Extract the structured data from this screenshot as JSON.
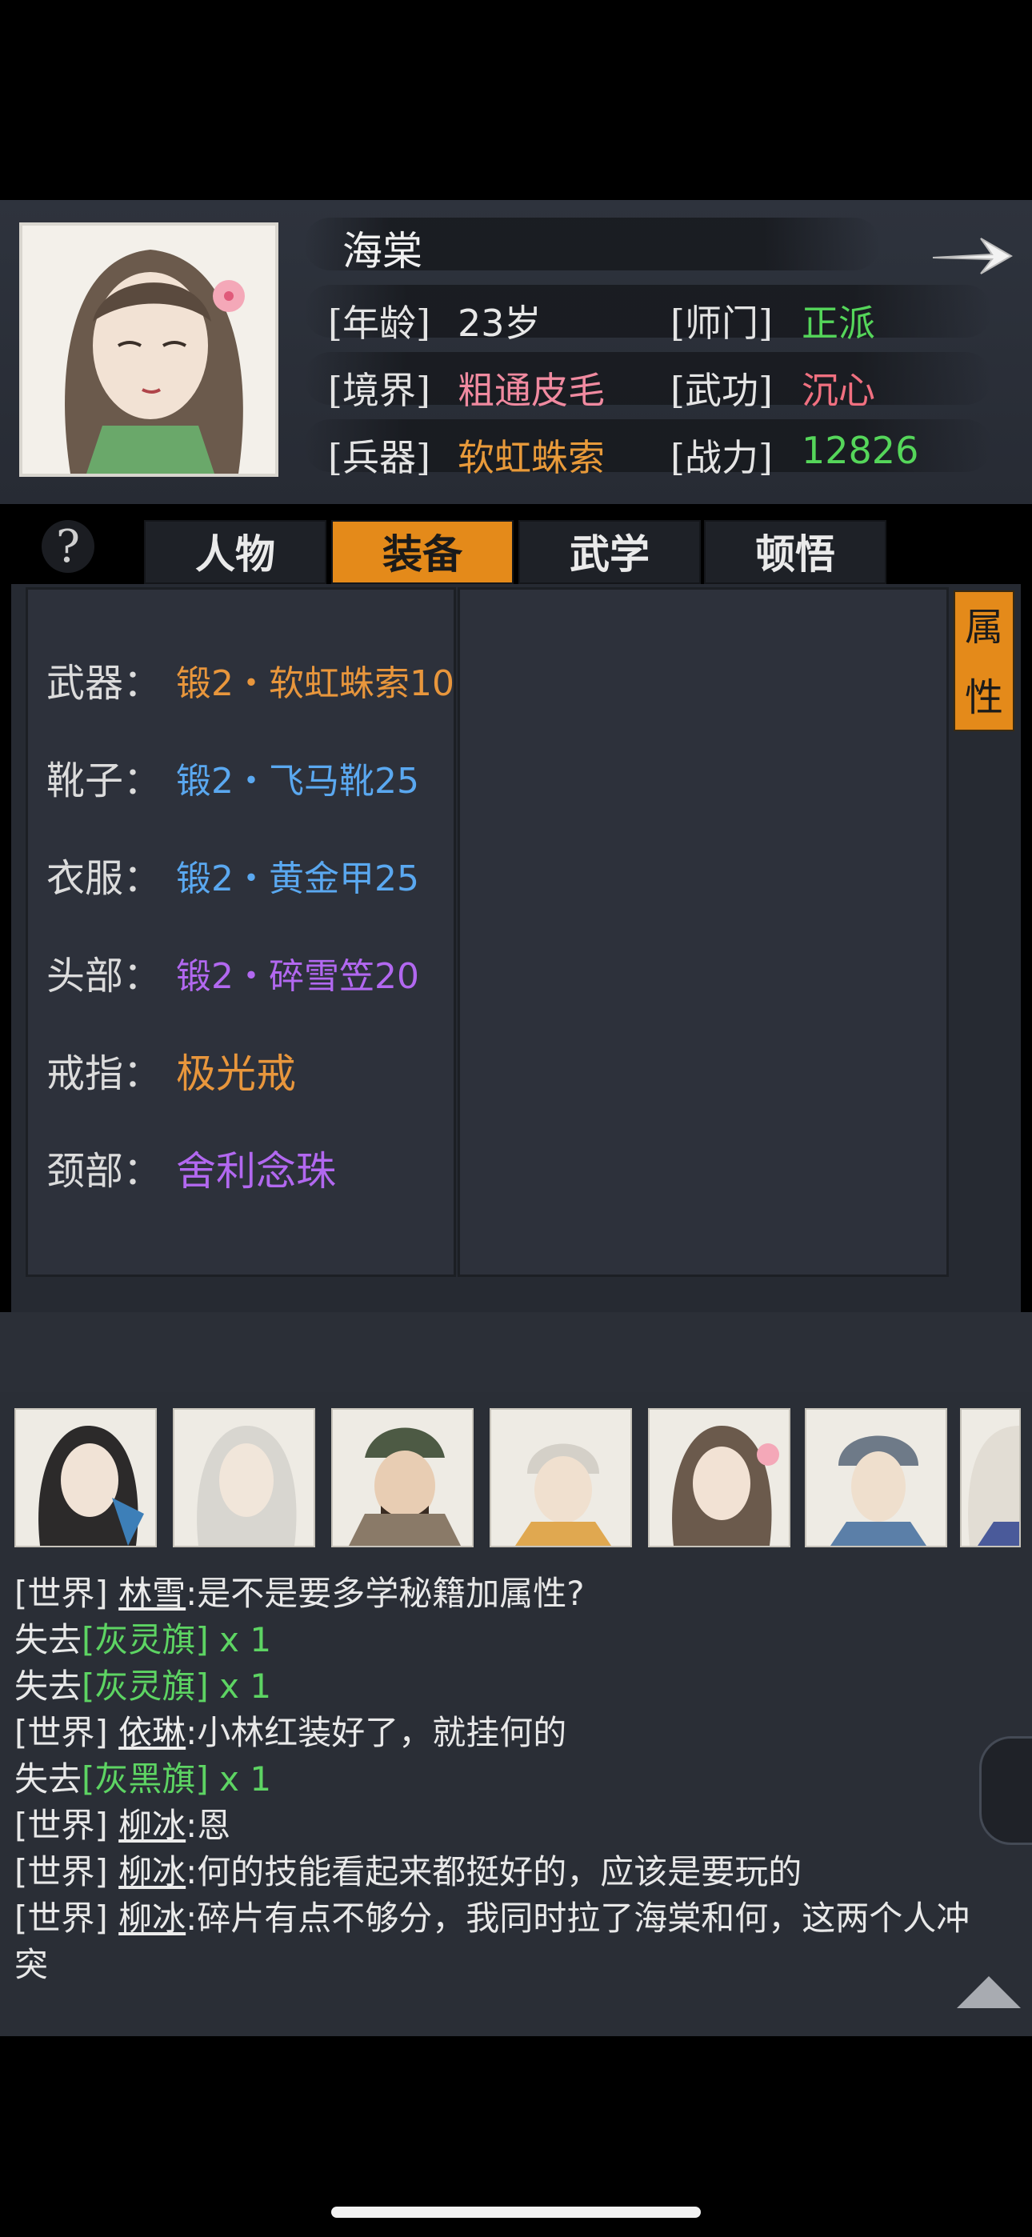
{
  "hero": {
    "name": "海棠",
    "fields": [
      {
        "label": "[年龄]",
        "value": "23岁",
        "color": "#e8e8e8"
      },
      {
        "label": "[师门]",
        "value": "正派",
        "color": "#55d65a"
      },
      {
        "label": "[境界]",
        "value": "粗通皮毛",
        "color": "#f08aa0"
      },
      {
        "label": "[武功]",
        "value": "沉心",
        "color": "#f07080"
      },
      {
        "label": "[兵器]",
        "value": "软虹蛛索",
        "color": "#e89a3a"
      },
      {
        "label": "[战力]",
        "value": "12826",
        "color": "#55d65a"
      }
    ]
  },
  "tabs": {
    "help": "?",
    "items": [
      {
        "label": "人物",
        "active": false
      },
      {
        "label": "装备",
        "active": true
      },
      {
        "label": "武学",
        "active": false
      },
      {
        "label": "顿悟",
        "active": false
      }
    ]
  },
  "attr_button": {
    "line1": "属",
    "line2": "性"
  },
  "equipment": [
    {
      "slot": "武器：",
      "item": "锻2・软虹蛛索10",
      "color": "#e8963c"
    },
    {
      "slot": "靴子：",
      "item": "锻2・飞马靴25",
      "color": "#5aa8f0"
    },
    {
      "slot": "衣服：",
      "item": "锻2・黄金甲25",
      "color": "#5aa8f0"
    },
    {
      "slot": "头部：",
      "item": "锻2・碎雪笠20",
      "color": "#b268f0"
    },
    {
      "slot": "戒指：",
      "item": "极光戒",
      "color": "#e8963c"
    },
    {
      "slot": "颈部：",
      "item": "舍利念珠",
      "color": "#b268f0"
    }
  ],
  "chat": [
    {
      "tag": "[世界]",
      "user": "林雪",
      "text": ":是不是要多学秘籍加属性?"
    },
    {
      "prefix": "失去",
      "item": "[灰灵旗]",
      "suffix": " x 1"
    },
    {
      "prefix": "失去",
      "item": "[灰灵旗]",
      "suffix": " x 1"
    },
    {
      "tag": "[世界]",
      "user": "依琳",
      "text": ":小林红装好了，就挂何的"
    },
    {
      "prefix": "失去",
      "item": "[灰黑旗]",
      "suffix": " x 1"
    },
    {
      "tag": "[世界]",
      "user": "柳冰",
      "text": ":恩"
    },
    {
      "tag": "[世界]",
      "user": "柳冰",
      "text": ":何的技能看起来都挺好的，应该是要玩的"
    },
    {
      "tag": "[世界]",
      "user": "柳冰",
      "text": ":碎片有点不够分，我同时拉了海棠和何，这两个人冲"
    },
    {
      "text": "突"
    }
  ]
}
